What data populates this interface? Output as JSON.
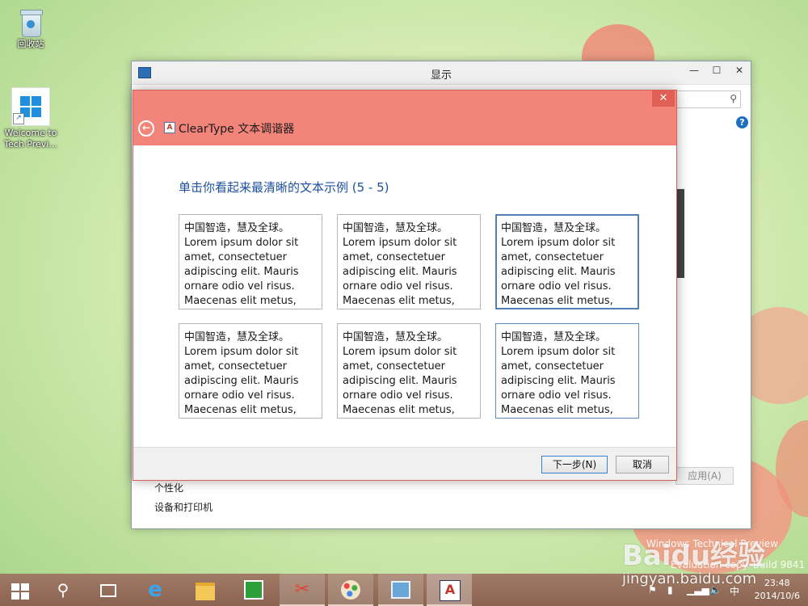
{
  "desktop": {
    "icons": [
      {
        "label": "回收站"
      },
      {
        "label": "Welcome to Tech Previ..."
      }
    ]
  },
  "background_window": {
    "title": "显示",
    "apply_label": "应用(A)",
    "links": [
      "个性化",
      "设备和打印机"
    ]
  },
  "dialog": {
    "title": "ClearType 文本调谐器",
    "instruction": "单击你看起来最清晰的文本示例 (5 - 5)",
    "samples": [
      [
        "中国智造，慧及全球。",
        "Lorem ipsum dolor sit",
        "amet, consectetuer",
        "adipiscing elit. Mauris",
        "ornare odio vel risus.",
        "Maecenas elit metus,"
      ],
      [
        "中国智造，慧及全球。",
        "Lorem ipsum dolor sit",
        "amet, consectetuer",
        "adipiscing elit. Mauris",
        "ornare odio vel risus.",
        "Maecenas elit metus,"
      ],
      [
        "中国智造，慧及全球。",
        "Lorem ipsum dolor sit",
        "amet, consectetuer",
        "adipiscing elit. Mauris",
        "ornare odio vel risus.",
        "Maecenas elit metus,"
      ],
      [
        "中国智造，慧及全球。",
        "Lorem ipsum dolor sit",
        "amet, consectetuer",
        "adipiscing elit. Mauris",
        "ornare odio vel risus.",
        "Maecenas elit metus,"
      ],
      [
        "中国智造，慧及全球。",
        "Lorem ipsum dolor sit",
        "amet, consectetuer",
        "adipiscing elit. Mauris",
        "ornare odio vel risus.",
        "Maecenas elit metus,"
      ],
      [
        "中国智造，慧及全球。",
        "Lorem ipsum dolor sit",
        "amet, consectetuer",
        "adipiscing elit. Mauris",
        "ornare odio vel risus.",
        "Maecenas elit metus,"
      ]
    ],
    "selected_sample": 3,
    "next_label": "下一步(N)",
    "cancel_label": "取消"
  },
  "taskbar": {
    "clock_time": "23:48",
    "clock_date": "2014/10/6",
    "ime": "中"
  },
  "watermark": {
    "brand": "Baidu经验",
    "url": "jingyan.baidu.com",
    "overlay_line1": "Windows Technical Preview",
    "overlay_line2": "Evaluation copy. Build 9841"
  },
  "colors": {
    "dialog_header": "#f2847a",
    "accent_blue": "#1c4f9c",
    "taskbar": "#8f6a55"
  }
}
